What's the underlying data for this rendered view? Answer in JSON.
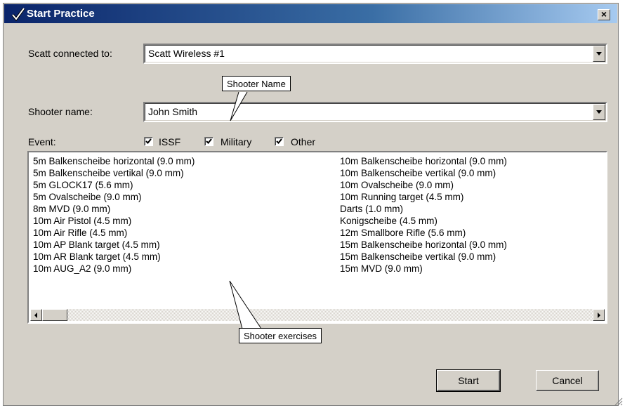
{
  "window": {
    "title": "Start Practice",
    "close_label": "×"
  },
  "scatt": {
    "label": "Scatt connected to:",
    "value": "Scatt Wireless #1"
  },
  "shooter": {
    "label": "Shooter name:",
    "value": "John Smith"
  },
  "event": {
    "label": "Event:",
    "filters": [
      {
        "label": "ISSF",
        "checked": true
      },
      {
        "label": "Military",
        "checked": true
      },
      {
        "label": "Other",
        "checked": true
      }
    ]
  },
  "exercises": {
    "column1": [
      "5m Balkenscheibe horizontal (9.0 mm)",
      "5m Balkenscheibe vertikal (9.0 mm)",
      "5m GLOCK17 (5.6 mm)",
      "5m Ovalscheibe (9.0 mm)",
      "8m MVD (9.0 mm)",
      "10m Air Pistol (4.5 mm)",
      "10m Air Rifle (4.5 mm)",
      "10m AP Blank target (4.5 mm)",
      "10m AR Blank target (4.5 mm)",
      "10m AUG_A2 (9.0 mm)"
    ],
    "column2": [
      "10m Balkenscheibe horizontal (9.0 mm)",
      "10m Balkenscheibe vertikal (9.0 mm)",
      "10m Ovalscheibe (9.0 mm)",
      "10m Running target (4.5 mm)",
      "Darts (1.0 mm)",
      "Konigscheibe (4.5 mm)",
      "12m Smallbore Rifle (5.6 mm)",
      "15m Balkenscheibe horizontal (9.0 mm)",
      "15m Balkenscheibe vertikal (9.0 mm)",
      "15m MVD (9.0 mm)"
    ]
  },
  "callouts": {
    "shooter_name": "Shooter Name",
    "shooter_exercises": "Shooter exercises"
  },
  "buttons": {
    "start": "Start",
    "cancel": "Cancel"
  },
  "colors": {
    "title_bar": "#0a246a",
    "face": "#d4d0c8"
  }
}
